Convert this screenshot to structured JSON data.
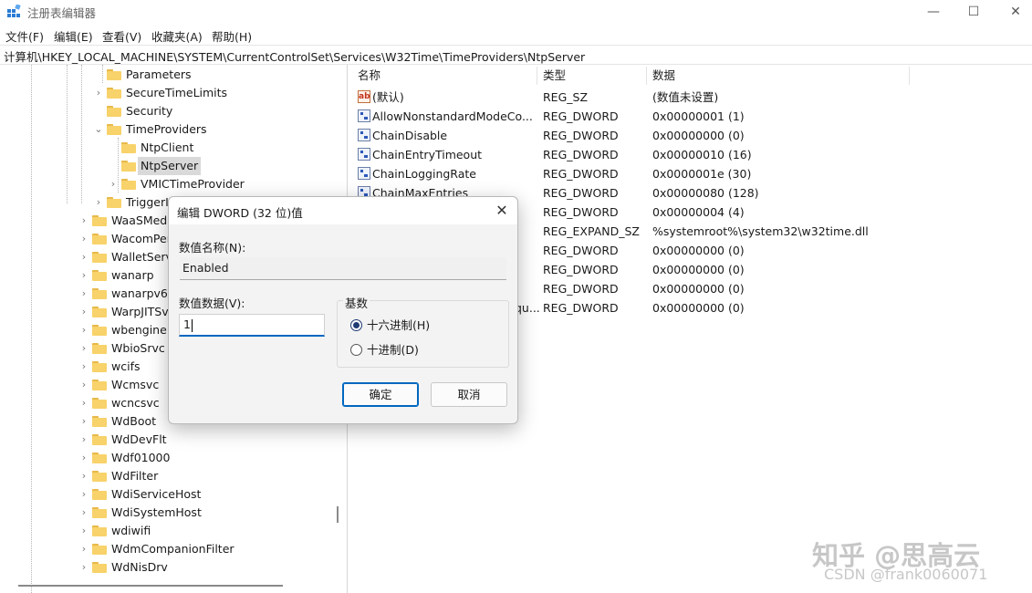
{
  "window": {
    "title": "注册表编辑器",
    "minimize": "—",
    "maximize": "☐",
    "close": "✕"
  },
  "menu": [
    {
      "label": "文件(F)"
    },
    {
      "label": "编辑(E)"
    },
    {
      "label": "查看(V)"
    },
    {
      "label": "收藏夹(A)"
    },
    {
      "label": "帮助(H)"
    }
  ],
  "address": "计算机\\HKEY_LOCAL_MACHINE\\SYSTEM\\CurrentControlSet\\Services\\W32Time\\TimeProviders\\NtpServer",
  "tree": [
    {
      "label": "Parameters",
      "expander": "",
      "selected": false
    },
    {
      "label": "SecureTimeLimits",
      "expander": "›",
      "selected": false
    },
    {
      "label": "Security",
      "expander": "",
      "selected": false
    },
    {
      "label": "TimeProviders",
      "expander": "⌄",
      "selected": false
    },
    {
      "label": "NtpClient",
      "expander": "",
      "selected": false
    },
    {
      "label": "NtpServer",
      "expander": "",
      "selected": true
    },
    {
      "label": "VMICTimeProvider",
      "expander": "›",
      "selected": false
    },
    {
      "label": "TriggerI",
      "expander": "›",
      "selected": false
    },
    {
      "label": "WaaSMedi",
      "expander": "›",
      "selected": false
    },
    {
      "label": "WacomPer",
      "expander": "›",
      "selected": false
    },
    {
      "label": "WalletServ",
      "expander": "›",
      "selected": false
    },
    {
      "label": "wanarp",
      "expander": "›",
      "selected": false
    },
    {
      "label": "wanarpv6",
      "expander": "›",
      "selected": false
    },
    {
      "label": "WarpJITSv",
      "expander": "›",
      "selected": false
    },
    {
      "label": "wbengine",
      "expander": "›",
      "selected": false
    },
    {
      "label": "WbioSrvc",
      "expander": "›",
      "selected": false
    },
    {
      "label": "wcifs",
      "expander": "›",
      "selected": false
    },
    {
      "label": "Wcmsvc",
      "expander": "›",
      "selected": false
    },
    {
      "label": "wcncsvc",
      "expander": "›",
      "selected": false
    },
    {
      "label": "WdBoot",
      "expander": "›",
      "selected": false
    },
    {
      "label": "WdDevFlt",
      "expander": "›",
      "selected": false
    },
    {
      "label": "Wdf01000",
      "expander": "›",
      "selected": false
    },
    {
      "label": "WdFilter",
      "expander": "›",
      "selected": false
    },
    {
      "label": "WdiServiceHost",
      "expander": "›",
      "selected": false
    },
    {
      "label": "WdiSystemHost",
      "expander": "›",
      "selected": false
    },
    {
      "label": "wdiwifi",
      "expander": "›",
      "selected": false
    },
    {
      "label": "WdmCompanionFilter",
      "expander": "›",
      "selected": false
    },
    {
      "label": "WdNisDrv",
      "expander": "›",
      "selected": false
    }
  ],
  "values": {
    "headers": {
      "name": "名称",
      "type": "类型",
      "data": "数据"
    },
    "rows": [
      {
        "icon": "sz",
        "icon_text": "ab",
        "name": "(默认)",
        "type": "REG_SZ",
        "data": "(数值未设置)"
      },
      {
        "icon": "dword",
        "icon_text": "",
        "name": "AllowNonstandardModeCo...",
        "type": "REG_DWORD",
        "data": "0x00000001 (1)"
      },
      {
        "icon": "dword",
        "icon_text": "",
        "name": "ChainDisable",
        "type": "REG_DWORD",
        "data": "0x00000000 (0)"
      },
      {
        "icon": "dword",
        "icon_text": "",
        "name": "ChainEntryTimeout",
        "type": "REG_DWORD",
        "data": "0x00000010 (16)"
      },
      {
        "icon": "dword",
        "icon_text": "",
        "name": "ChainLoggingRate",
        "type": "REG_DWORD",
        "data": "0x0000001e (30)"
      },
      {
        "icon": "dword",
        "icon_text": "",
        "name": "ChainMaxEntries",
        "type": "REG_DWORD",
        "data": "0x00000080 (128)"
      },
      {
        "icon": "dword",
        "icon_text": "",
        "name": "",
        "type": "REG_DWORD",
        "data": "0x00000004 (4)"
      },
      {
        "icon": "",
        "icon_text": "",
        "name": "",
        "type": "REG_EXPAND_SZ",
        "data": "%systemroot%\\system32\\w32time.dll"
      },
      {
        "icon": "",
        "icon_text": "",
        "name": "",
        "type": "REG_DWORD",
        "data": "0x00000000 (0)"
      },
      {
        "icon": "",
        "icon_text": "",
        "name": "",
        "type": "REG_DWORD",
        "data": "0x00000000 (0)"
      },
      {
        "icon": "",
        "icon_text": "",
        "name": "",
        "type": "REG_DWORD",
        "data": "0x00000000 (0)"
      },
      {
        "icon": "",
        "icon_text": "",
        "name": "qu...",
        "type": "REG_DWORD",
        "data": "0x00000000 (0)"
      }
    ]
  },
  "dialog": {
    "title": "编辑 DWORD (32 位)值",
    "close": "✕",
    "name_label": "数值名称(N):",
    "name_value": "Enabled",
    "data_label": "数值数据(V):",
    "data_value": "1",
    "base_label": "基数",
    "hex_label": "十六进制(H)",
    "dec_label": "十进制(D)",
    "selected_base": "hex",
    "ok": "确定",
    "cancel": "取消"
  },
  "watermark": {
    "line1": "知乎 @思高云",
    "line2": "CSDN @frank0060071"
  },
  "colors": {
    "folder": "#f8d26a",
    "focus_blue": "#0067c0",
    "selection": "#d9d9d9"
  }
}
